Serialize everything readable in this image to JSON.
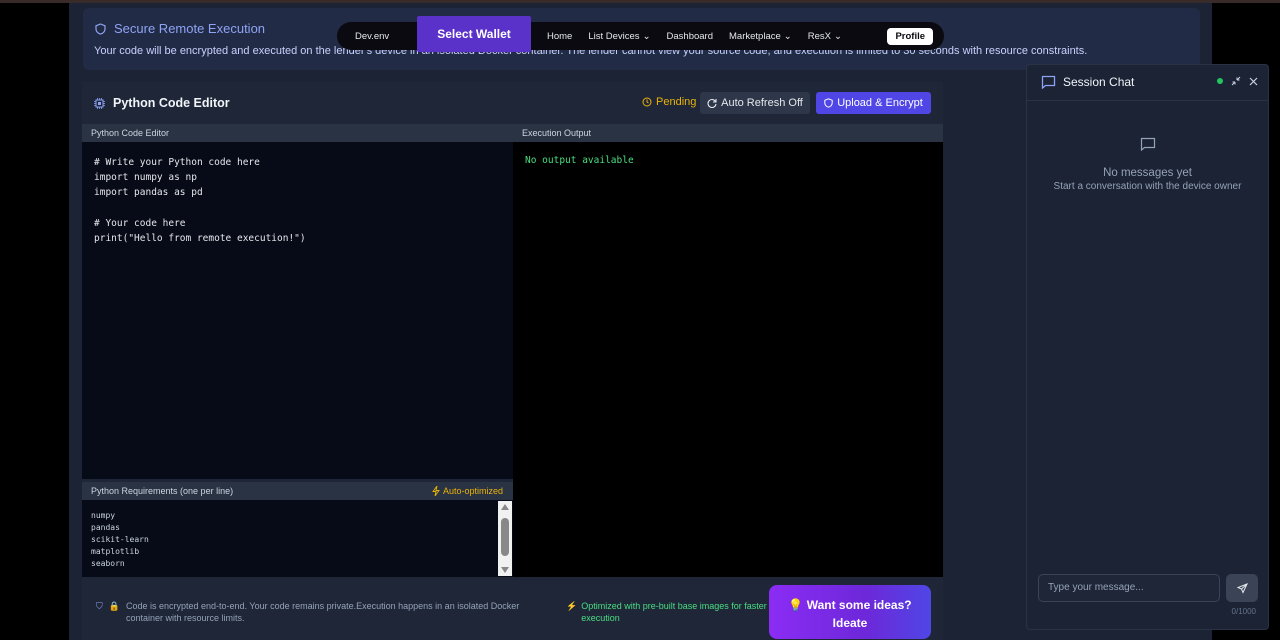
{
  "notice": {
    "title": "Secure Remote Execution",
    "text": "Your code will be encrypted and executed on the lender's device in an isolated Docker container. The lender cannot view your source code, and execution is limited to 30 seconds with resource constraints."
  },
  "nav": {
    "brand": "Dev.env",
    "wallet": "Select Wallet",
    "items": [
      "Home",
      "List Devices",
      "Dashboard",
      "Marketplace",
      "ResX"
    ],
    "profile": "Profile"
  },
  "editor": {
    "title": "Python Code Editor",
    "status": "Pending",
    "refresh_label": "Auto Refresh Off",
    "upload_label": "Upload & Encrypt",
    "code_label": "Python Code Editor",
    "output_label": "Execution Output",
    "code": "# Write your Python code here\nimport numpy as np\nimport pandas as pd\n\n# Your code here\nprint(\"Hello from remote execution!\")",
    "output": "No output available",
    "requirements_label": "Python Requirements (one per line)",
    "auto_optimized": "Auto-optimized",
    "requirements": [
      "numpy",
      "pandas",
      "scikit-learn",
      "matplotlib",
      "seaborn"
    ]
  },
  "footer": {
    "note": "Code is encrypted end-to-end. Your code remains private.Execution happens in an isolated Docker container with resource limits.",
    "optimized": "Optimized with pre-built base images for faster execution",
    "ideas_line1": "Want some ideas?",
    "ideas_line2": "Ideate"
  },
  "chat": {
    "title": "Session Chat",
    "empty_title": "No messages yet",
    "empty_sub": "Start a conversation with the device owner",
    "placeholder": "Type your message...",
    "count": "0/1000"
  },
  "colors": {
    "accent": "#4f46e5",
    "wallet": "#5b32c9",
    "pending": "#eab308",
    "output_green": "#4ade80"
  }
}
